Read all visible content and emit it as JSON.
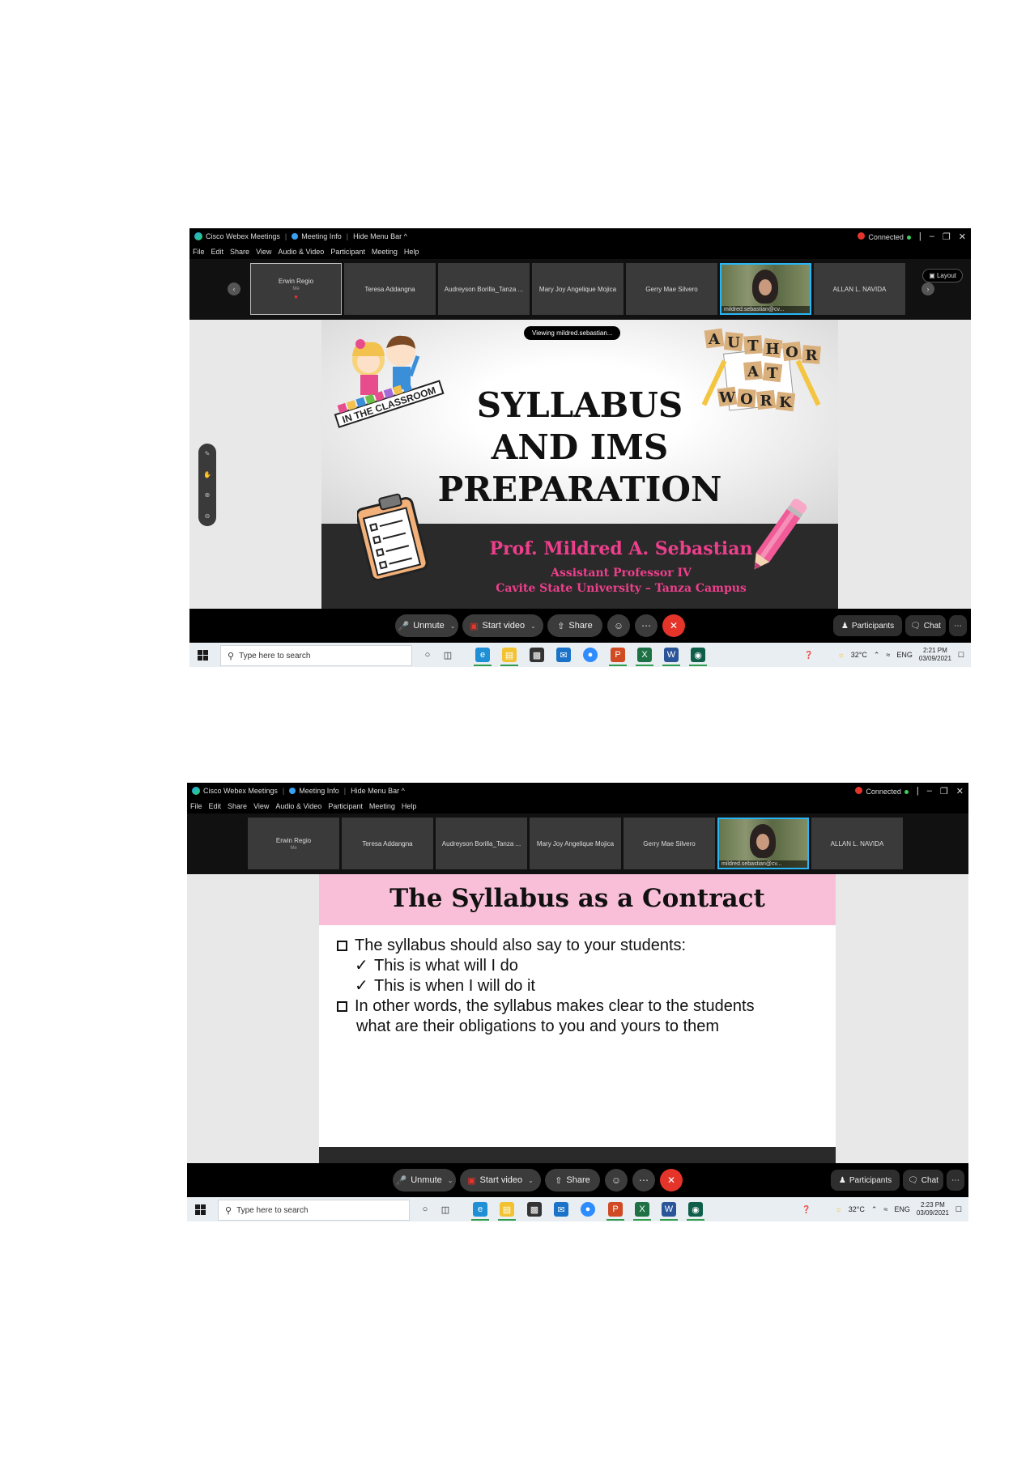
{
  "app": {
    "title": "Cisco Webex Meetings",
    "meeting_info": "Meeting Info",
    "hide_menu": "Hide Menu Bar ^",
    "status": "Connected"
  },
  "menu": [
    "File",
    "Edit",
    "Share",
    "View",
    "Audio & Video",
    "Participant",
    "Meeting",
    "Help"
  ],
  "participants": [
    {
      "name": "Erwin Regio",
      "sub": "Me"
    },
    {
      "name": "Teresa Addangna"
    },
    {
      "name": "Audreyson Borilla_Tanza ..."
    },
    {
      "name": "Mary Joy Angelique Mojica"
    },
    {
      "name": "Gerry Mae Silvero"
    },
    {
      "name": "mildred.sebastian@cv..."
    },
    {
      "name": "ALLAN L. NAVIDA"
    }
  ],
  "layout_label": "Layout",
  "viewing_label": "Viewing mildred.sebastian...",
  "slide1": {
    "title_lines": [
      "SYLLABUS",
      "AND IMS",
      "PREPARATION"
    ],
    "presenter": "Prof. Mildred A. Sebastian",
    "position": "Assistant Professor IV",
    "campus": "Cavite State University – Tanza Campus",
    "art_left_text": "IN THE CLASSROOM",
    "art_right_text": [
      "A",
      "U",
      "T",
      "H",
      "O",
      "R",
      "A",
      "T",
      "W",
      "O",
      "R",
      "K"
    ]
  },
  "slide2": {
    "title": "The Syllabus as a Contract",
    "bullets": [
      {
        "type": "box",
        "text": "The syllabus should also say to your students:"
      },
      {
        "type": "check",
        "text": "This is what will I do"
      },
      {
        "type": "check",
        "text": "This is when I will do it"
      },
      {
        "type": "box",
        "text": "In other words, the syllabus makes clear to the students"
      },
      {
        "type": "cont",
        "text": "what are their obligations to you and yours to them"
      }
    ]
  },
  "controls": {
    "unmute": "Unmute",
    "start_video": "Start video",
    "share": "Share",
    "participants": "Participants",
    "chat": "Chat"
  },
  "taskbar": {
    "search_placeholder": "Type here to search",
    "temperature": "32°C",
    "language": "ENG",
    "date": "03/09/2021",
    "time1": "2:21 PM",
    "time2": "2:23 PM"
  },
  "colors": {
    "accent_pink": "#ee3f8c",
    "header_pink": "#f9bfd8",
    "end_red": "#e5352b",
    "active_blue": "#29b6f6"
  }
}
